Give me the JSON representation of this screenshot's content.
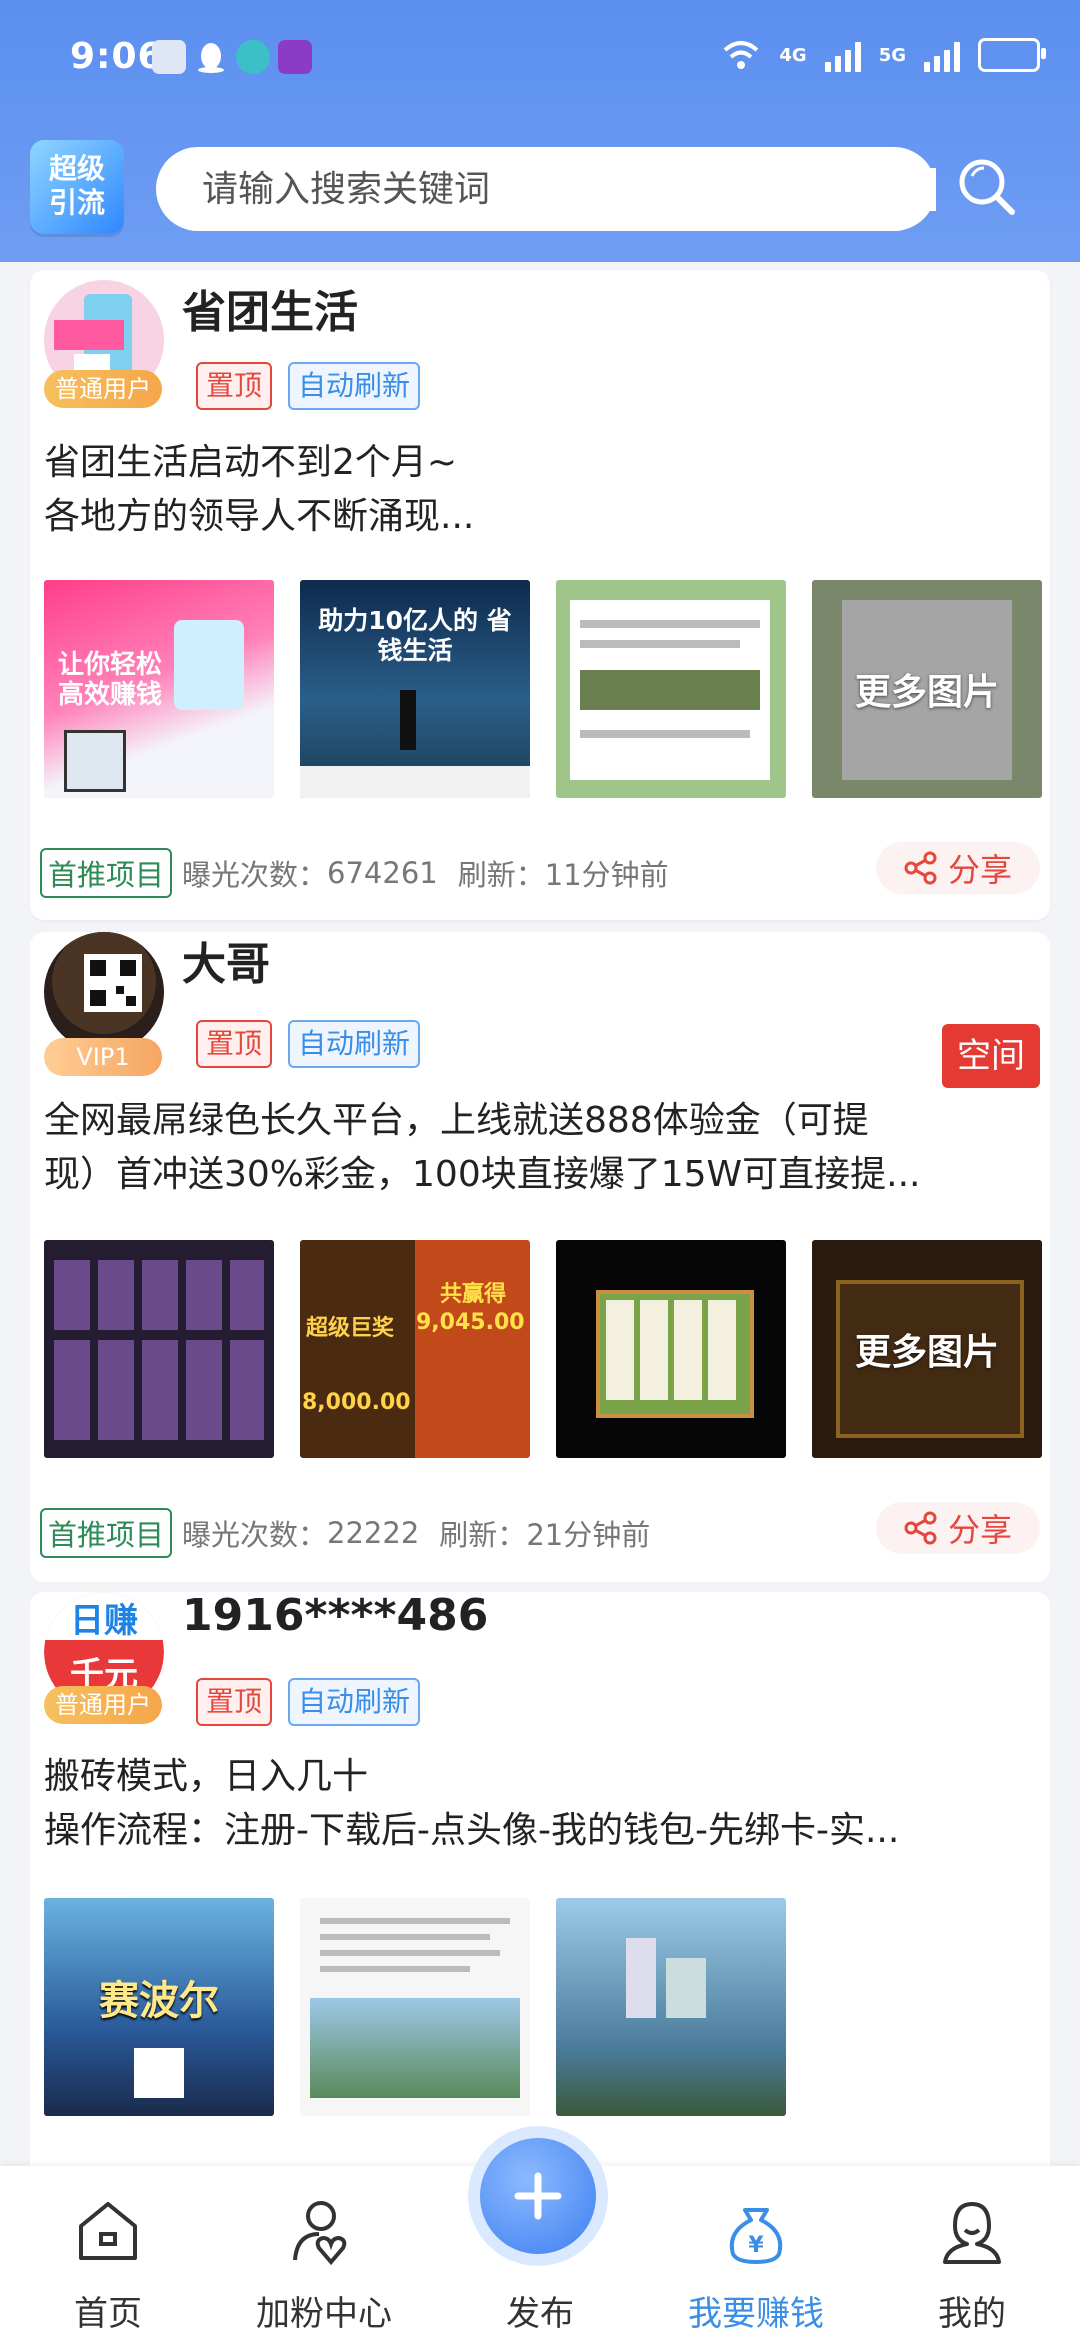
{
  "status_bar": {
    "time": "9:06",
    "net1": "4G",
    "net2": "5G"
  },
  "header": {
    "logo_line1": "超级",
    "logo_line2": "引流",
    "search_placeholder": "请输入搜索关键词"
  },
  "posts": [
    {
      "username": "省团生活",
      "level": "普通用户",
      "tag_top": "置顶",
      "tag_auto": "自动刷新",
      "desc_line1": "省团生活启动不到2个月~",
      "desc_line2": "各地方的领导人不断涌现...",
      "thumb1_text": "让你轻松 高效赚钱",
      "thumb2_text": "助力10亿人的 省钱生活",
      "more_images": "更多图片",
      "recommend": "首推项目",
      "exposure_label": "曝光次数：",
      "exposure": "674261",
      "refresh_label": "刷新：",
      "refresh": "11分钟前",
      "share": "分享"
    },
    {
      "username": "大哥",
      "level": "VIP1",
      "tag_top": "置顶",
      "tag_auto": "自动刷新",
      "space": "空间",
      "desc_line1": "全网最屌绿色长久平台，上线就送888体验金（可提",
      "desc_line2": "现）首冲送30%彩金，100块直接爆了15W可直接提...",
      "thumb2_text1": "超级巨奖",
      "thumb2_text2": "共赢得",
      "thumb2_text3": "9,045.00",
      "thumb2_text4": "8,000.00",
      "more_images": "更多图片",
      "recommend": "首推项目",
      "exposure_label": "曝光次数：",
      "exposure": "22222",
      "refresh_label": "刷新：",
      "refresh": "21分钟前",
      "share": "分享"
    },
    {
      "username": "1916****486",
      "level": "普通用户",
      "avatar_text1": "日赚",
      "avatar_text2": "千元",
      "tag_top": "置顶",
      "tag_auto": "自动刷新",
      "desc_line1": "搬砖模式，日入几十",
      "desc_line2": "操作流程：注册-下载后-点头像-我的钱包-先绑卡-实...",
      "thumb1_text": "赛波尔"
    }
  ],
  "bottom_nav": {
    "home": "首页",
    "fans": "加粉中心",
    "publish": "发布",
    "earn": "我要赚钱",
    "me": "我的"
  },
  "colors": {
    "accent": "#3a8ee6",
    "header": "#6f9df3",
    "red": "#e5473d",
    "green": "#2e8b57"
  }
}
